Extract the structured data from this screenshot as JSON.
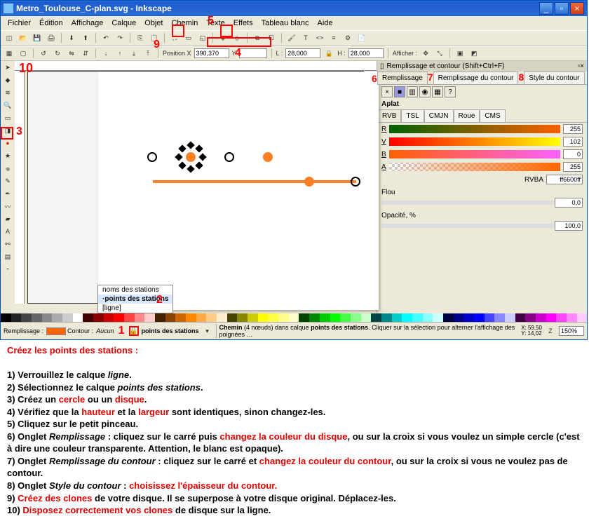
{
  "title": "Metro_Toulouse_C-plan.svg - Inkscape",
  "menu": [
    "Fichier",
    "Édition",
    "Affichage",
    "Calque",
    "Objet",
    "Chemin",
    "Texte",
    "Effets",
    "Tableau blanc",
    "Aide"
  ],
  "toolbar2": {
    "posXLabel": "Position X",
    "posX": "390,370",
    "posY": "Y",
    "lLabel": "L :",
    "lVal": "28,000",
    "hLabel": "H :",
    "hVal": "28,000",
    "afficherLabel": "Afficher :"
  },
  "dock": {
    "title": "Remplissage et contour (Shift+Ctrl+F)",
    "tabs": [
      "Remplissage",
      "Remplissage du contour",
      "Style du contour"
    ],
    "aplat": "Aplat",
    "modes": [
      "RVB",
      "TSL",
      "CMJN",
      "Roue",
      "CMS"
    ],
    "channels": {
      "R": "255",
      "V": "102",
      "B": "0",
      "A": "255"
    },
    "rvba": "RVBA",
    "rvbaVal": "ff6600ff",
    "flou": "Flou",
    "flouVal": "0,0",
    "opacite": "Opacité, %",
    "opaciteVal": "100,0"
  },
  "layers": {
    "popup": [
      "noms des stations",
      "·points des stations",
      "[ligne]"
    ],
    "current": "points des stations"
  },
  "status": {
    "fillLabel": "Remplissage :",
    "strokeLabel": "Contour :",
    "strokeVal": "Aucun",
    "msg1": "Chemin",
    "msg2": "(4 nœuds) dans calque",
    "msg3": "points des stations",
    "msg4": ". Cliquer sur la sélection pour alterner l'affichage des poignées …",
    "zoom": "150%",
    "coordsX": "X: 59,50",
    "coordsY": "Y: 14,02"
  },
  "annotations": {
    "n1": "1",
    "n2": "2",
    "n3": "3",
    "n4": "4",
    "n5": "5",
    "n6": "6",
    "n7": "7",
    "n8": "8",
    "n9": "9",
    "n10": "10"
  },
  "instr": {
    "h": "Créez les points des stations :",
    "l1a": "1) Verrouillez le calque ",
    "l1b": "ligne",
    "l1c": ".",
    "l2a": "2) Sélectionnez le calque ",
    "l2b": "points des stations",
    "l2c": ".",
    "l3a": "3) Créez un ",
    "l3b": "cercle",
    "l3c": " ou un ",
    "l3d": "disque",
    "l3e": ".",
    "l4a": "4) Vérifiez que la ",
    "l4b": "hauteur",
    "l4c": " et la ",
    "l4d": "largeur",
    "l4e": " sont identiques, sinon changez-les.",
    "l5": "5) Cliquez sur le petit pinceau.",
    "l6a": "6) Onglet ",
    "l6b": "Remplissage",
    "l6c": " : cliquez sur le carré puis ",
    "l6d": "changez la couleur du disque",
    "l6e": ", ou sur la croix si vous voulez un simple cercle (c'est à dire une couleur transparente. Attention, le blanc est opaque).",
    "l7a": "7) Onglet ",
    "l7b": "Remplissage du contour",
    "l7c": " : cliquez sur le carré et ",
    "l7d": "changez la couleur du contour",
    "l7e": ", ou sur la croix si vous ne voulez pas de contour.",
    "l8a": "8) Onglet ",
    "l8b": "Style du contour",
    "l8c": " : ",
    "l8d": "choisissez l'épaisseur du contour.",
    "l9a": "9) ",
    "l9b": "Créez des clones",
    "l9c": " de votre disque. Il se superpose à votre disque original. Déplacez-les.",
    "l10a": "10) ",
    "l10b": "Disposez correctement vos clones",
    "l10c": " de disque sur la ligne."
  }
}
